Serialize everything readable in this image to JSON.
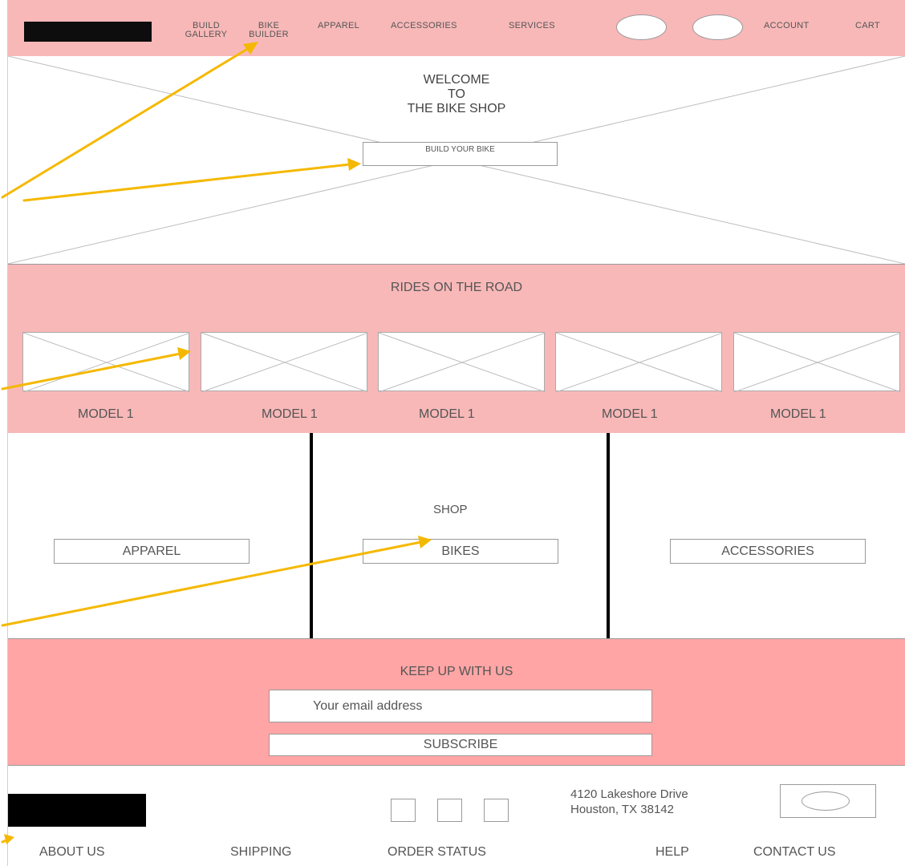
{
  "header": {
    "nav": [
      {
        "line1": "BUILD",
        "line2": "GALLERY"
      },
      {
        "line1": "BIKE",
        "line2": "BUILDER"
      },
      {
        "line1": "APPAREL",
        "line2": ""
      },
      {
        "line1": "ACCESSORIES",
        "line2": ""
      },
      {
        "line1": "SERVICES",
        "line2": ""
      }
    ],
    "account": "ACCOUNT",
    "cart": "CART"
  },
  "hero": {
    "title_line1": "WELCOME",
    "title_line2": "TO",
    "title_line3": "THE BIKE SHOP",
    "cta": "BUILD YOUR BIKE"
  },
  "rides": {
    "title": "RIDES ON THE ROAD",
    "models": [
      "MODEL 1",
      "MODEL 1",
      "MODEL 1",
      "MODEL 1",
      "MODEL 1"
    ]
  },
  "shop": {
    "title": "SHOP",
    "apparel": "APPAREL",
    "bikes": "BIKES",
    "accessories": "ACCESSORIES"
  },
  "newsletter": {
    "title": "KEEP UP WITH US",
    "email_placeholder": "Your email address",
    "subscribe": "SUBSCRIBE"
  },
  "footer": {
    "address_line1": "4120 Lakeshore Drive",
    "address_line2": "Houston, TX 38142",
    "links": [
      "ABOUT US",
      "SHIPPING",
      "ORDER STATUS",
      "HELP",
      "CONTACT US"
    ]
  },
  "colors": {
    "header_pink": "#f8b8b8",
    "newsletter_pink": "#ffa5a5",
    "arrow_yellow": "#f5b800"
  }
}
